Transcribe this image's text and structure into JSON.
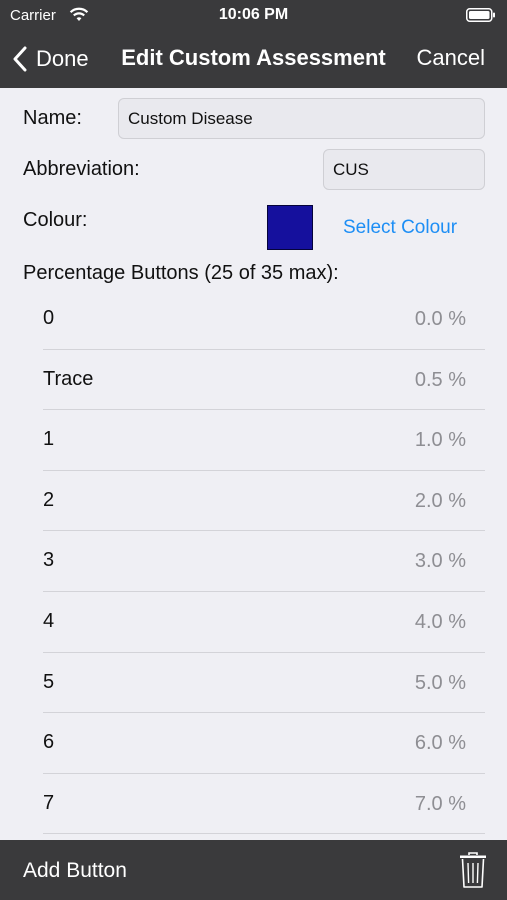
{
  "status_bar": {
    "carrier": "Carrier",
    "time": "10:06 PM"
  },
  "nav": {
    "back_label": "Done",
    "title": "Edit Custom Assessment",
    "cancel_label": "Cancel"
  },
  "form": {
    "name_label": "Name:",
    "name_value": "Custom Disease",
    "abbreviation_label": "Abbreviation:",
    "abbreviation_value": "CUS",
    "colour_label": "Colour:",
    "colour_swatch": "#15109d",
    "select_colour_label": "Select Colour",
    "percentage_heading": "Percentage Buttons (25 of 35 max):"
  },
  "percentage_buttons": [
    {
      "label": "0",
      "value": "0.0 %"
    },
    {
      "label": "Trace",
      "value": "0.5 %"
    },
    {
      "label": "1",
      "value": "1.0 %"
    },
    {
      "label": "2",
      "value": "2.0 %"
    },
    {
      "label": "3",
      "value": "3.0 %"
    },
    {
      "label": "4",
      "value": "4.0 %"
    },
    {
      "label": "5",
      "value": "5.0 %"
    },
    {
      "label": "6",
      "value": "6.0 %"
    },
    {
      "label": "7",
      "value": "7.0 %"
    }
  ],
  "toolbar": {
    "add_label": "Add Button",
    "delete_icon": "trash-icon"
  },
  "colors": {
    "bar_background": "#3a3a3c",
    "link": "#1d8ef5",
    "value_text": "#8e8e93"
  }
}
